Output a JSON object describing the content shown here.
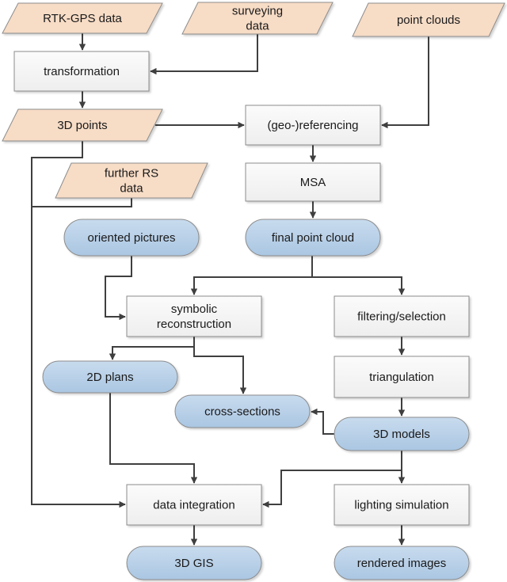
{
  "diagram": {
    "colors": {
      "input_fill": "#f7dcc6",
      "process_fill": "#f3f3f3",
      "output_fill": "#b9d2e8",
      "stroke": "#8c8c8c",
      "edge": "#3f3f3f"
    },
    "nodes": [
      {
        "id": "rtk",
        "type": "input",
        "lines": [
          "RTK-GPS data"
        ]
      },
      {
        "id": "survey",
        "type": "input",
        "lines": [
          "surveying",
          "data"
        ]
      },
      {
        "id": "clouds",
        "type": "input",
        "lines": [
          "point clouds"
        ]
      },
      {
        "id": "transform",
        "type": "process",
        "lines": [
          "transformation"
        ]
      },
      {
        "id": "points3d",
        "type": "input",
        "lines": [
          "3D points"
        ]
      },
      {
        "id": "georef",
        "type": "process",
        "lines": [
          "(geo-)referencing"
        ]
      },
      {
        "id": "furtherrs",
        "type": "input",
        "lines": [
          "further RS",
          "data"
        ]
      },
      {
        "id": "msa",
        "type": "process",
        "lines": [
          "MSA"
        ]
      },
      {
        "id": "oriented",
        "type": "output",
        "lines": [
          "oriented pictures"
        ]
      },
      {
        "id": "finalcloud",
        "type": "output",
        "lines": [
          "final point cloud"
        ]
      },
      {
        "id": "symbolic",
        "type": "process",
        "lines": [
          "symbolic",
          "reconstruction"
        ]
      },
      {
        "id": "filtering",
        "type": "process",
        "lines": [
          "filtering/selection"
        ]
      },
      {
        "id": "plans2d",
        "type": "output",
        "lines": [
          "2D plans"
        ]
      },
      {
        "id": "triang",
        "type": "process",
        "lines": [
          "triangulation"
        ]
      },
      {
        "id": "cross",
        "type": "output",
        "lines": [
          "cross-sections"
        ]
      },
      {
        "id": "models3d",
        "type": "output",
        "lines": [
          "3D models"
        ]
      },
      {
        "id": "integration",
        "type": "process",
        "lines": [
          "data integration"
        ]
      },
      {
        "id": "lighting",
        "type": "process",
        "lines": [
          "lighting simulation"
        ]
      },
      {
        "id": "gis3d",
        "type": "output",
        "lines": [
          "3D GIS"
        ]
      },
      {
        "id": "rendered",
        "type": "output",
        "lines": [
          "rendered images"
        ]
      }
    ],
    "edges": [
      {
        "from": "rtk",
        "to": "transform"
      },
      {
        "from": "survey",
        "to": "transform"
      },
      {
        "from": "transform",
        "to": "points3d"
      },
      {
        "from": "points3d",
        "to": "georef"
      },
      {
        "from": "clouds",
        "to": "georef"
      },
      {
        "from": "georef",
        "to": "msa"
      },
      {
        "from": "msa",
        "to": "finalcloud"
      },
      {
        "from": "finalcloud",
        "to": "symbolic"
      },
      {
        "from": "finalcloud",
        "to": "filtering"
      },
      {
        "from": "oriented",
        "to": "symbolic"
      },
      {
        "from": "symbolic",
        "to": "plans2d"
      },
      {
        "from": "symbolic",
        "to": "cross"
      },
      {
        "from": "filtering",
        "to": "triang"
      },
      {
        "from": "triang",
        "to": "models3d"
      },
      {
        "from": "models3d",
        "to": "cross"
      },
      {
        "from": "models3d",
        "to": "lighting"
      },
      {
        "from": "models3d",
        "to": "integration"
      },
      {
        "from": "plans2d",
        "to": "integration"
      },
      {
        "from": "points3d",
        "to": "integration"
      },
      {
        "from": "furtherrs",
        "to": "integration"
      },
      {
        "from": "integration",
        "to": "gis3d"
      },
      {
        "from": "lighting",
        "to": "rendered"
      }
    ]
  }
}
